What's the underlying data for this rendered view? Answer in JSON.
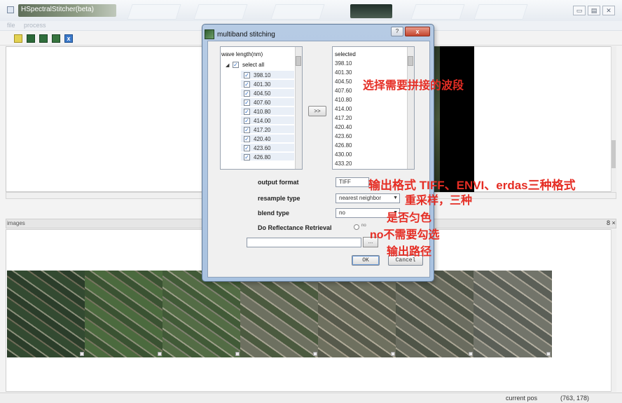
{
  "app": {
    "title": "HSpectralStitcher(beta)",
    "menu": [
      "file",
      "process"
    ],
    "toolbar_icons": [
      "open-folder-icon",
      "image-icon",
      "image-icon",
      "image-icon",
      "close-x-icon"
    ],
    "window_buttons": [
      "▭",
      "▤",
      "✕"
    ]
  },
  "dialog": {
    "title": "multiband stitching",
    "help_label": "?",
    "close_label": "x",
    "left_list": {
      "header": "wave length(nm)",
      "select_all": "select all",
      "items": [
        "398.10",
        "401.30",
        "404.50",
        "407.60",
        "410.80",
        "414.00",
        "417.20",
        "420.40",
        "423.60",
        "426.80"
      ]
    },
    "move_button": ">>",
    "right_list": {
      "header": "selected",
      "items": [
        "398.10",
        "401.30",
        "404.50",
        "407.60",
        "410.80",
        "414.00",
        "417.20",
        "420.40",
        "423.60",
        "426.80",
        "430.00",
        "433.20"
      ]
    },
    "output_format": {
      "label": "output format",
      "value": "TIFF"
    },
    "resample_type": {
      "label": "resample type",
      "value": "nearest neighbor"
    },
    "blend_type": {
      "label": "blend type",
      "value": "no"
    },
    "reflectance": {
      "label": "Do Reflectance Retrieval",
      "radio_label": "no"
    },
    "output_path": {
      "value": "",
      "browse_label": "..."
    },
    "ok_label": "OK",
    "cancel_label": "Cancel"
  },
  "annotations": {
    "select_bands": "选择需要拼接的波段",
    "output_format_note": "输出格式 TIFF、ENVI、erdas三种格式",
    "resample_note": "重采样，三种",
    "blend_note": "是否匀色",
    "reflectance_note": "no不需要勾选",
    "output_path_note": "输出路径"
  },
  "images_panel": {
    "label": "images",
    "controls": "8 ×"
  },
  "status": {
    "label": "current pos",
    "value": "(763, 178)"
  },
  "colors": {
    "annotation": "#e52d24",
    "dialog_frame": "#b6cbe4"
  }
}
